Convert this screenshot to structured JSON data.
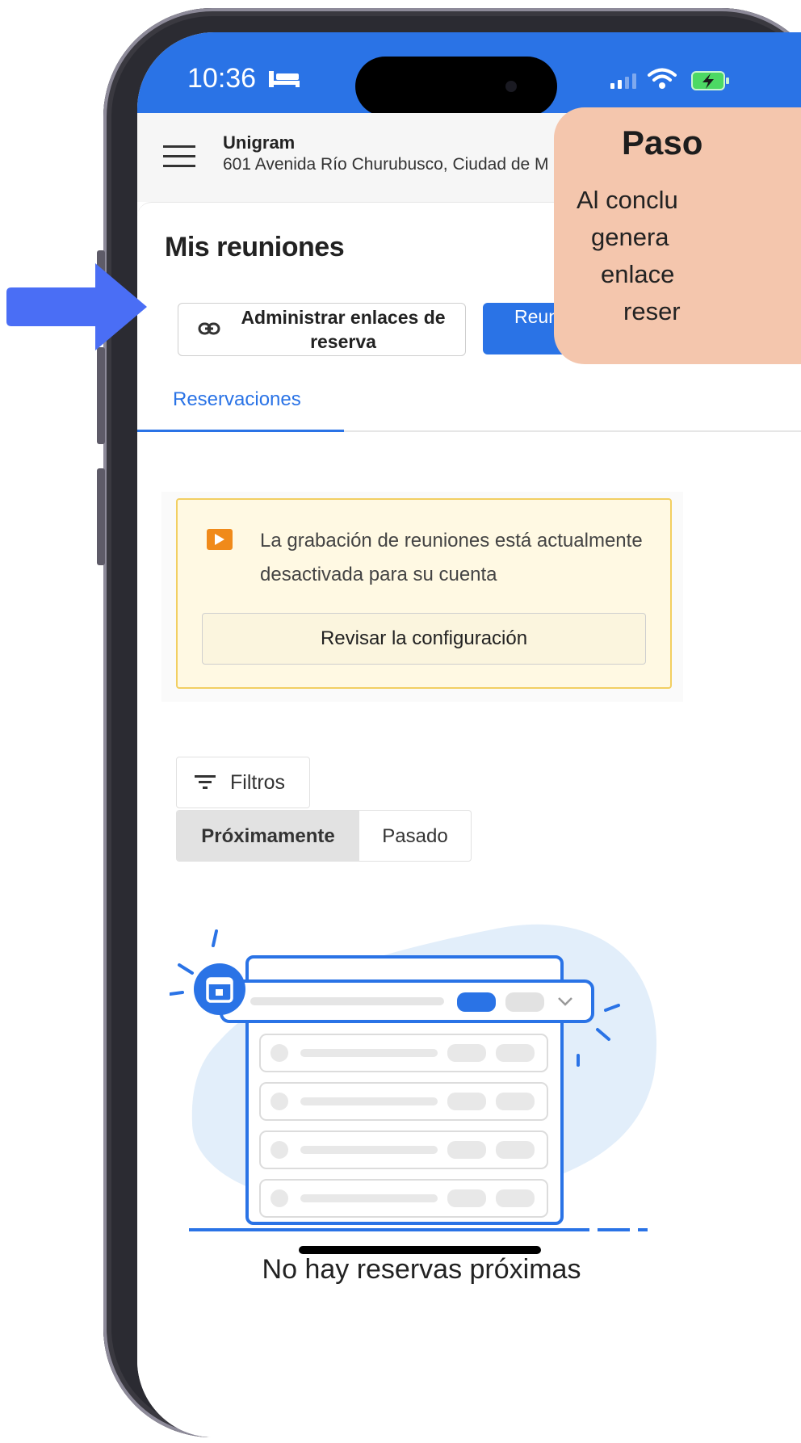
{
  "status_bar": {
    "time": "10:36"
  },
  "app_header": {
    "org_name": "Unigram",
    "org_address": "601 Avenida Río Churubusco, Ciudad de M"
  },
  "page": {
    "title": "Mis reuniones",
    "admin_button_label": "Administrar enlaces de reserva",
    "reunion_button_label": "Reunio de libr",
    "tab_reservations": "Reservaciones"
  },
  "notice": {
    "text": "La grabación de reuniones está actualmente desactivada para su cuenta",
    "button_label": "Revisar la configuración"
  },
  "filters": {
    "label": "Filtros",
    "segments": {
      "upcoming": "Próximamente",
      "past": "Pasado"
    }
  },
  "empty_state": {
    "text": "No hay reservas próximas"
  },
  "tip_card": {
    "title": "Paso",
    "lines": [
      "Al conclu",
      "genera",
      "enlace",
      "reser"
    ]
  },
  "colors": {
    "brand_blue": "#2a73e6",
    "tip_background": "#f4c6ad",
    "arrow": "#4a6ef5",
    "notice_background": "#fff9e3",
    "notice_border": "#f2cf62"
  }
}
